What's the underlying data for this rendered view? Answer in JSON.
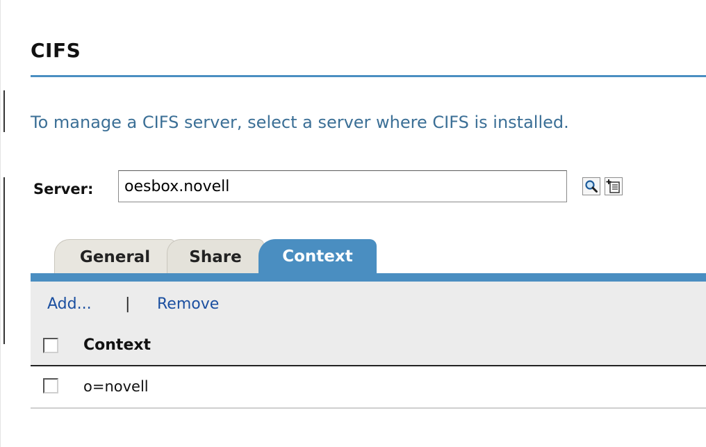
{
  "page": {
    "title": "CIFS",
    "instructions": "To manage a CIFS server, select a server where CIFS is installed."
  },
  "server": {
    "label": "Server:",
    "value": "oesbox.novell",
    "search_icon": "magnifier-icon",
    "browse_icon": "object-browser-icon"
  },
  "tabs": [
    {
      "label": "General",
      "active": false
    },
    {
      "label": "Share",
      "active": false
    },
    {
      "label": "Context",
      "active": true
    }
  ],
  "actions": {
    "add": "Add...",
    "separator": "|",
    "remove": "Remove"
  },
  "table": {
    "column_header": "Context",
    "rows": [
      {
        "value": "o=novell",
        "checked": false
      }
    ]
  },
  "colors": {
    "accent": "#4a8ec1",
    "link": "#1b4fa0",
    "instruction_text": "#3b6f96",
    "panel_bg": "#ececec"
  }
}
